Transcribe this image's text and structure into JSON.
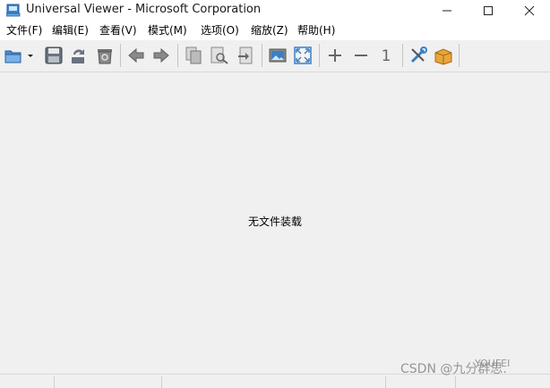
{
  "window": {
    "title": "Universal Viewer - Microsoft Corporation",
    "controls": [
      "minimize",
      "maximize",
      "close"
    ]
  },
  "menu": {
    "items": [
      "文件(F)",
      "编辑(E)",
      "查看(V)",
      "模式(M)",
      "选项(O)",
      "缩放(Z)",
      "帮助(H)"
    ]
  },
  "toolbar": {
    "buttons": [
      {
        "icon": "open-folder-icon"
      },
      {
        "icon": "dropdown-arrow-icon"
      },
      {
        "icon": "save-icon"
      },
      {
        "icon": "reload-icon"
      },
      {
        "icon": "recycle-bin-icon"
      },
      {
        "icon": "back-arrow-icon"
      },
      {
        "icon": "forward-arrow-icon"
      },
      {
        "icon": "copy-icon"
      },
      {
        "icon": "find-icon"
      },
      {
        "icon": "goto-icon"
      },
      {
        "icon": "image-view-icon"
      },
      {
        "icon": "fit-window-icon"
      },
      {
        "icon": "zoom-in-icon"
      },
      {
        "icon": "zoom-out-icon"
      },
      {
        "icon": "original-size-icon",
        "label": "1"
      },
      {
        "icon": "tools-icon"
      },
      {
        "icon": "plugin-box-icon"
      }
    ]
  },
  "content": {
    "empty_message": "无文件装载"
  },
  "watermark": {
    "text": "CSDN @九分群思.",
    "text2": "YOUFEI"
  },
  "colors": {
    "background": "#f0f0f0",
    "toolbar_blue": "#3b7fc4",
    "icon_gray": "#707070"
  }
}
